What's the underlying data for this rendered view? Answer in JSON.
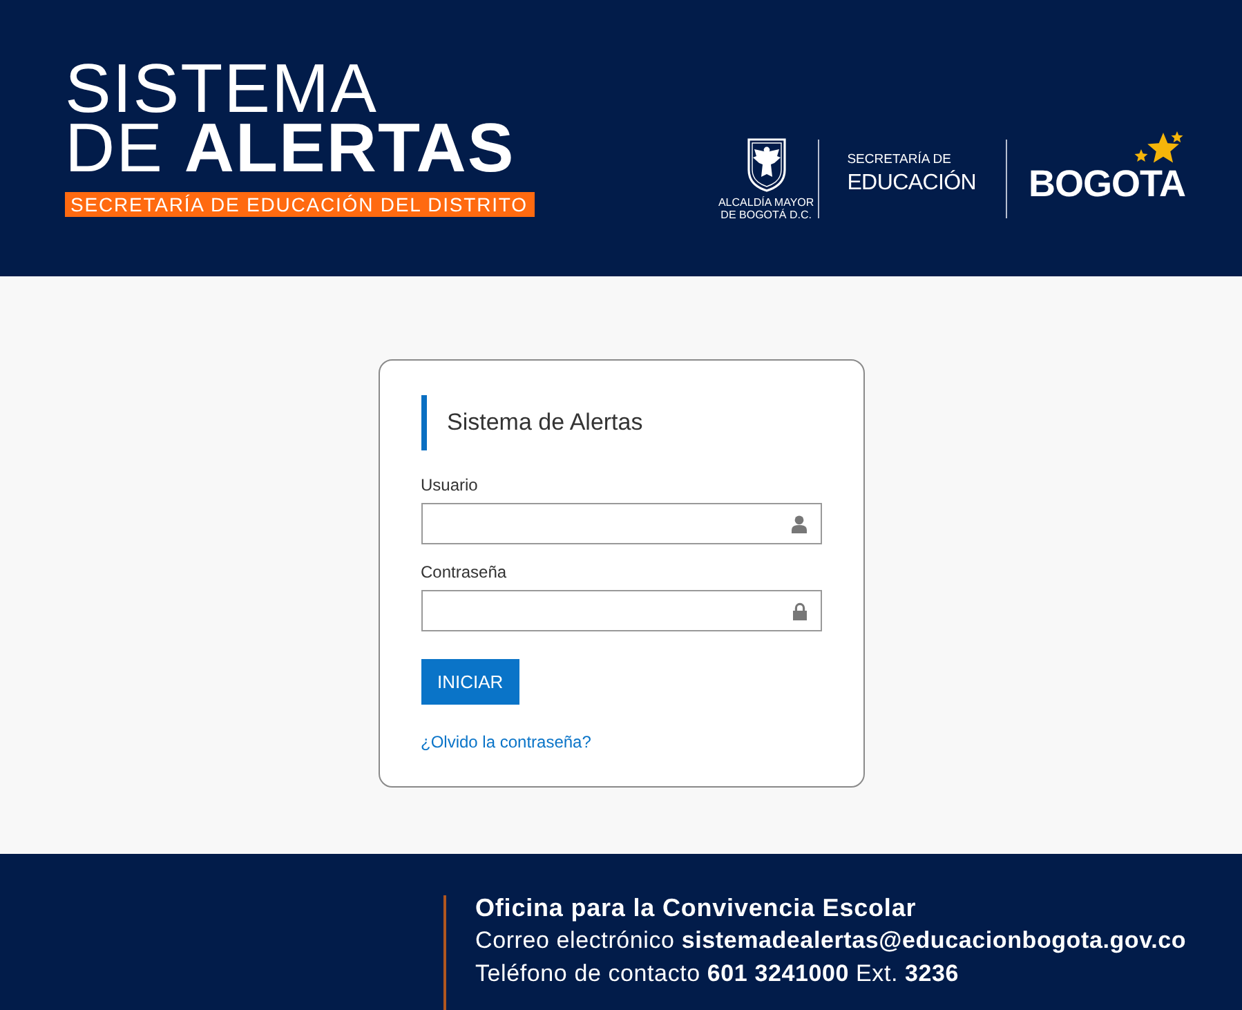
{
  "header": {
    "title_line_1": "SISTEMA",
    "title_line_2": "DE **ALERTAS**",
    "subtitle": "SECRETARÍA DE EDUCACIÓN DEL DISTRITO",
    "logos": {
      "crest_caption": [
        "ALCALDÍA MAYOR",
        "DE BOGOTÁ D.C."
      ],
      "department_small": "SECRETARÍA DE",
      "department_large": "EDUCACIÓN",
      "city": "BOGOTA"
    }
  },
  "login_card": {
    "title": "Sistema de Alertas",
    "fields": [
      {
        "label": "Usuario",
        "kind": "user"
      },
      {
        "label": "Contraseña",
        "kind": "password"
      }
    ],
    "submit_button": "INICIAR",
    "forgot_link": "¿Olvido la contraseña?"
  },
  "footer": {
    "title": "Oficina para la Convivencia Escolar",
    "lines": [
      "Correo electrónico **sistemadealertas@educacionbogota.gov.co**",
      "Teléfono de contacto **601 3241000** Ext. **3236**"
    ]
  }
}
